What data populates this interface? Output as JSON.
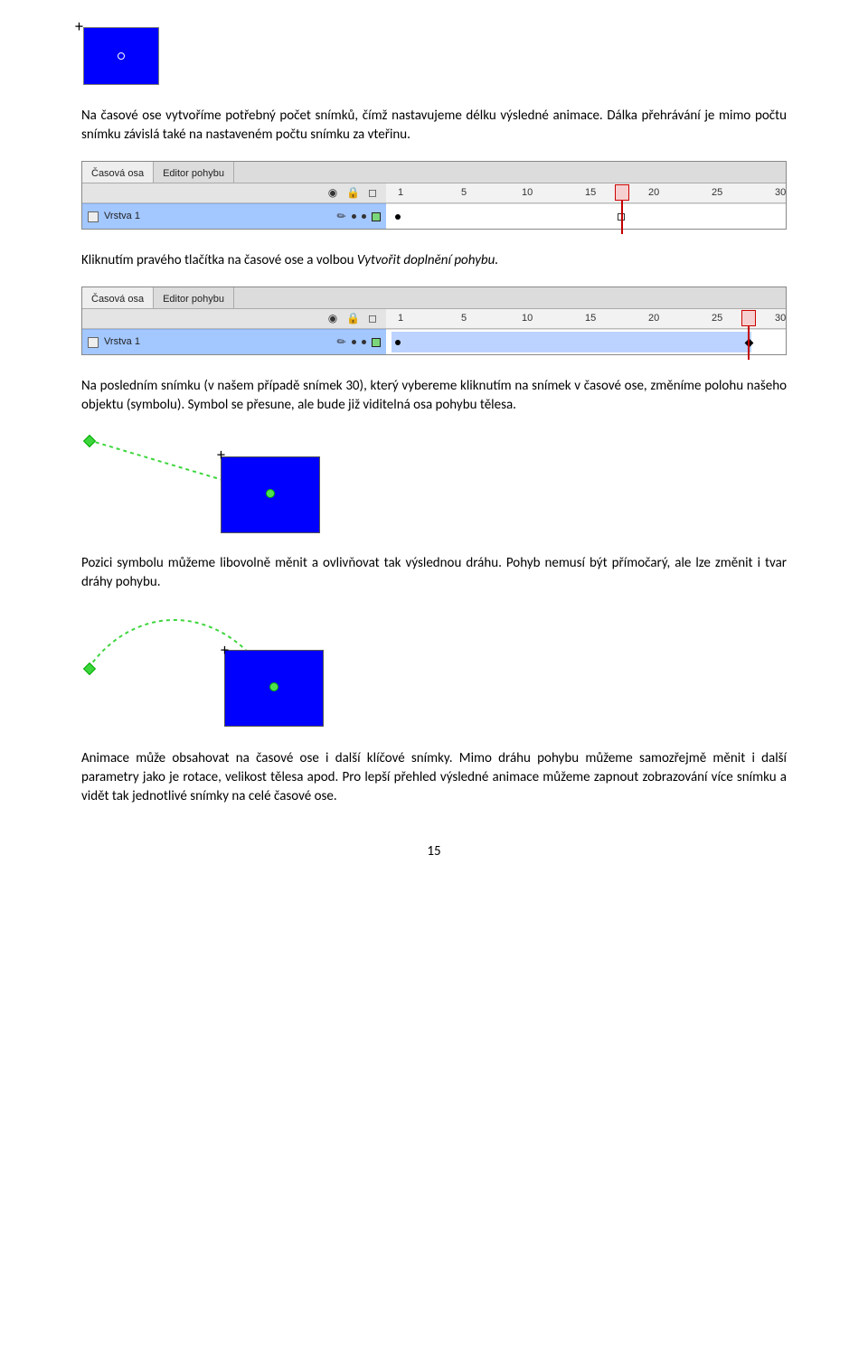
{
  "figure1": {
    "alt": "Modrý obdélník se symbolem"
  },
  "para1": "Na časové ose vytvoříme potřebný počet snímků, čímž nastavujeme délku výsledné animace. Dálka přehrávání je mimo počtu snímku závislá také na nastaveném počtu snímku za vteřinu.",
  "timeline1": {
    "tab_active": "Časová osa",
    "tab_inactive": "Editor pohybu",
    "layer": "Vrstva 1",
    "ruler": [
      "1",
      "5",
      "10",
      "15",
      "20",
      "25",
      "30"
    ],
    "playhead_at": 19,
    "keyframe_at": 1,
    "hollow_at": 19
  },
  "para2_a": "Kliknutím pravého tlačítka na časové ose a volbou ",
  "para2_b": "Vytvořit doplnění pohybu.",
  "timeline2": {
    "tab_active": "Časová osa",
    "tab_inactive": "Editor pohybu",
    "layer": "Vrstva 1",
    "ruler": [
      "1",
      "5",
      "10",
      "15",
      "20",
      "25",
      "30"
    ],
    "playhead_at": 30,
    "tween_from": 1,
    "tween_to": 30
  },
  "para3": "Na posledním snímku (v našem případě snímek 30), který vybereme kliknutím na snímek v časové ose, změníme polohu našeho objektu (symbolu). Symbol se přesune, ale bude již viditelná osa pohybu tělesa.",
  "para4": "Pozici symbolu můžeme libovolně měnit a ovlivňovat tak výslednou dráhu. Pohyb nemusí být přímočarý, ale lze změnit i tvar dráhy pohybu.",
  "para5": "Animace může obsahovat na časové ose i další klíčové snímky. Mimo dráhu pohybu můžeme samozřejmě měnit i další parametry jako je rotace, velikost tělesa apod. Pro lepší přehled výsledné animace můžeme zapnout zobrazování více snímku a vidět tak jednotlivé snímky na celé časové ose.",
  "page_number": "15",
  "icons": {
    "eye": "◉",
    "lock": "🔒",
    "outline": "◻"
  }
}
